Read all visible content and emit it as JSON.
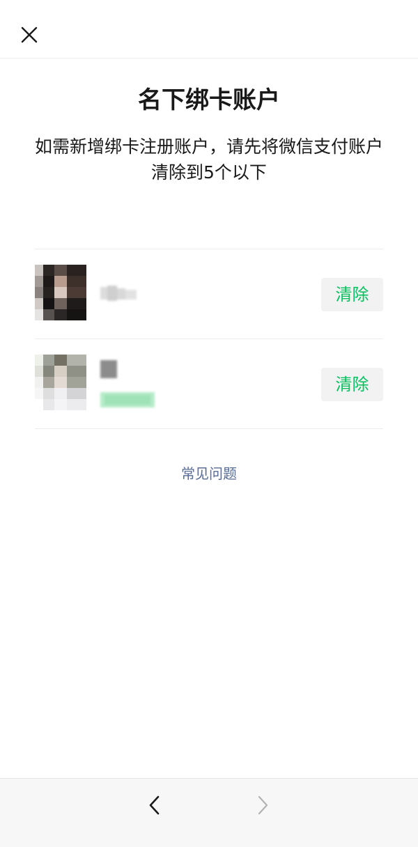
{
  "header": {
    "close_icon": "close-icon"
  },
  "title": "名下绑卡账户",
  "description": "如需新增绑卡注册账户，请先将微信支付账户清除到5个以下",
  "accounts": [
    {
      "avatar": "blurred-avatar",
      "name": "",
      "clear_label": "清除"
    },
    {
      "avatar": "blurred-avatar",
      "name": "",
      "clear_label": "清除"
    }
  ],
  "faq_label": "常见问题",
  "bottom_nav": {
    "back_icon": "chevron-left-icon",
    "forward_icon": "chevron-right-icon"
  },
  "colors": {
    "accent_green": "#07c160",
    "link_blue": "#576b95",
    "button_bg": "#f2f2f2",
    "bottom_bar_bg": "#f7f7f7"
  }
}
